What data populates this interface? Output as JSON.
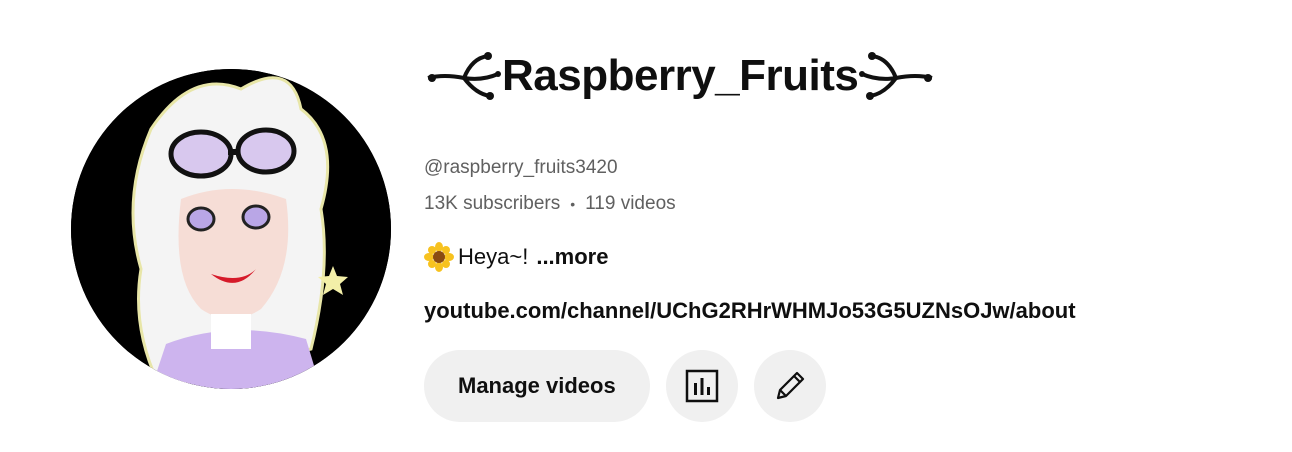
{
  "channel": {
    "name": "Raspberry_Fruits",
    "handle": "@raspberry_fruits3420",
    "subscribers": "13K subscribers",
    "separator": "•",
    "videos": "119 videos",
    "description": "Heya~!",
    "more_label": "...more",
    "link": "youtube.com/channel/UChG2RHrWHMJo53G5UZNsOJw/about"
  },
  "actions": {
    "manage_videos_label": "Manage videos",
    "analytics_icon": "analytics-icon",
    "edit_icon": "pencil-icon"
  },
  "colors": {
    "text_primary": "#0f0f0f",
    "text_secondary": "#606060",
    "button_bg": "#f0f0f0"
  }
}
